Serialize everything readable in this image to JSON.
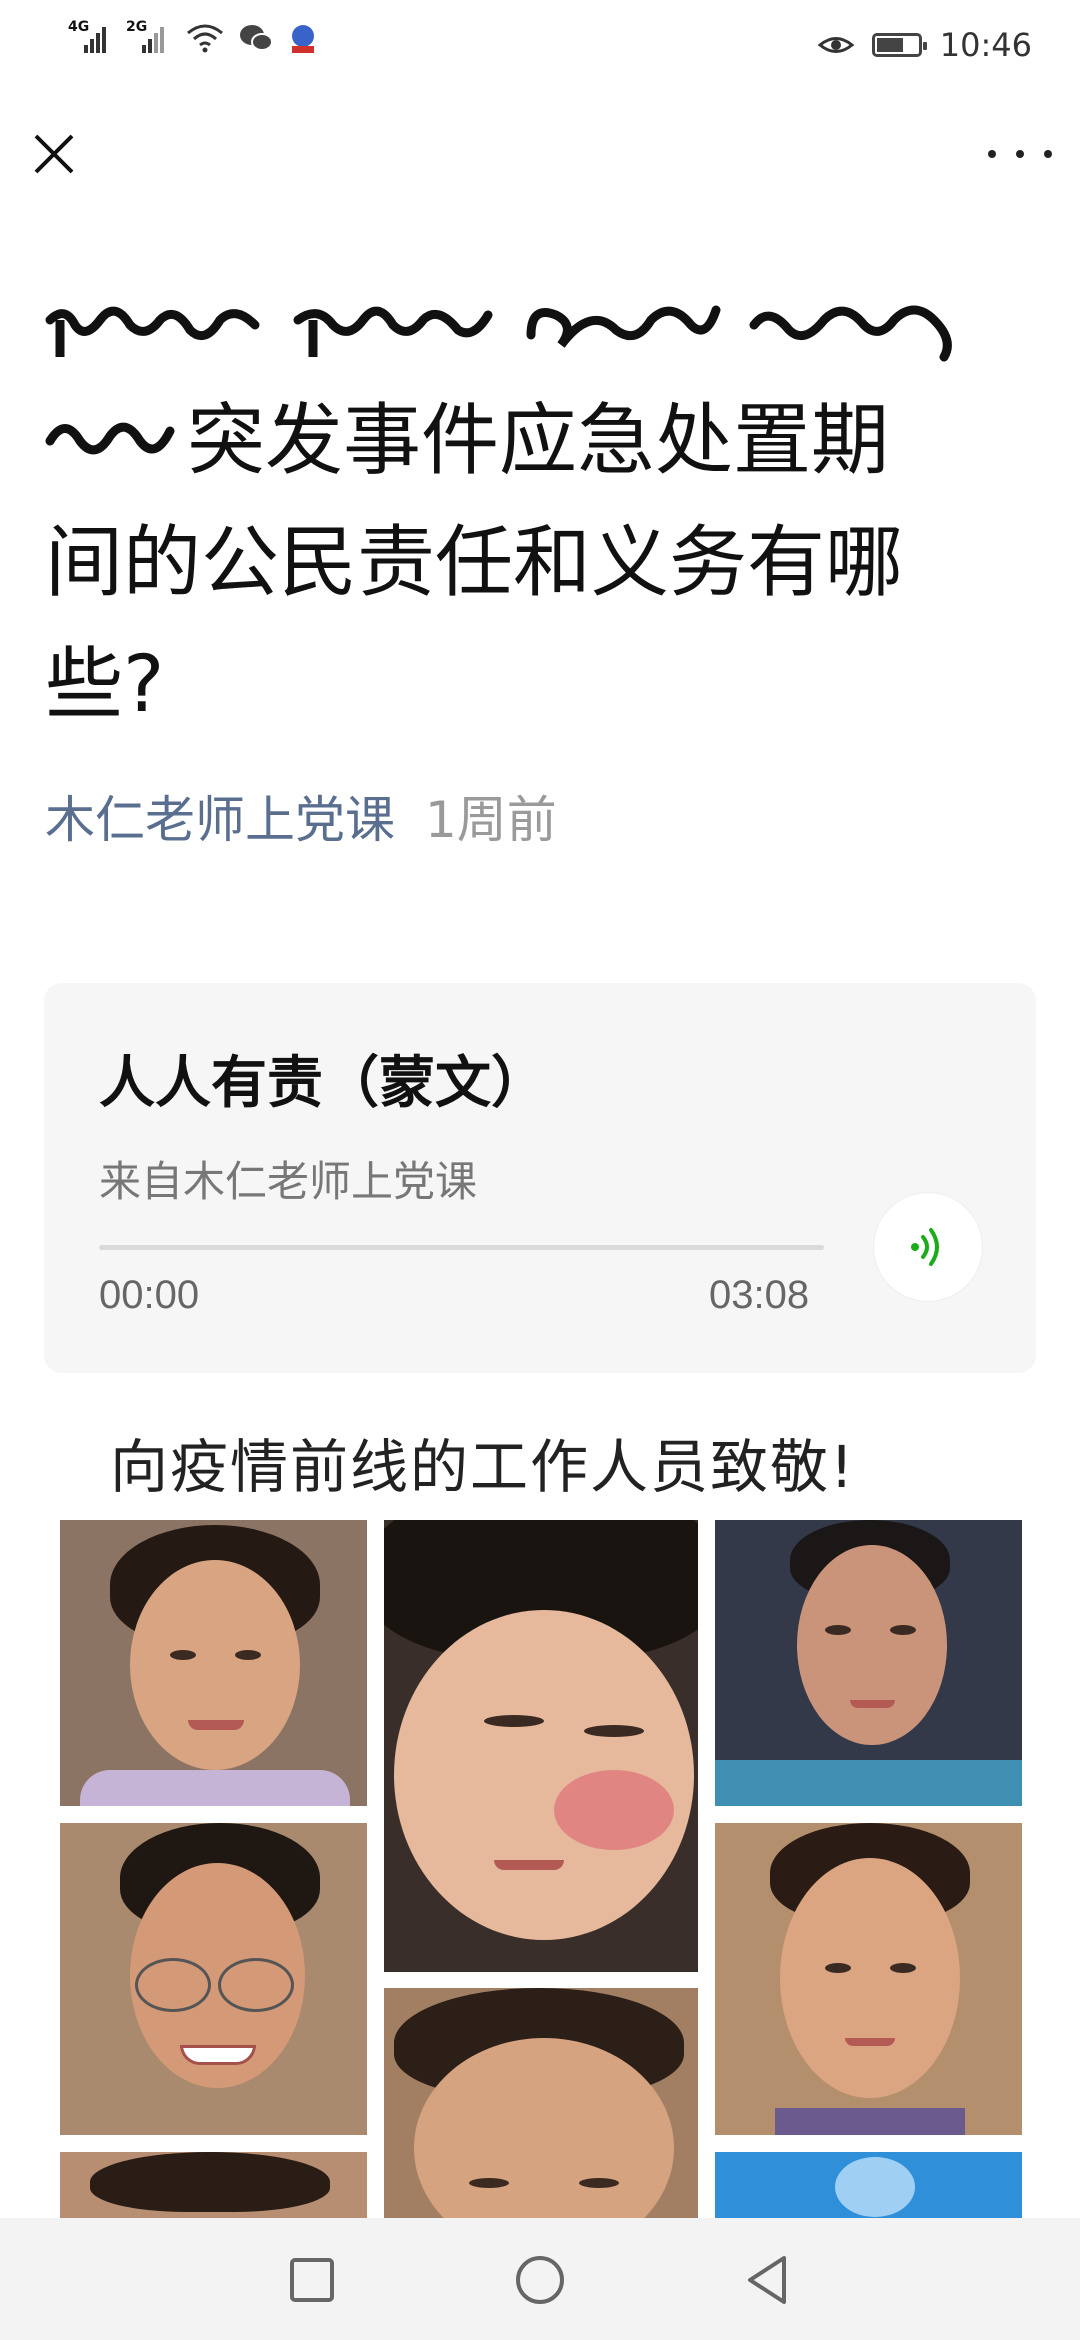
{
  "status_bar": {
    "time": "10:46",
    "signal_1": "4G",
    "signal_2": "2G",
    "icons": [
      "signal-4g-icon",
      "signal-2g-icon",
      "wifi-icon",
      "wechat-icon",
      "baidu-icon",
      "eye-icon",
      "battery-icon"
    ]
  },
  "nav": {
    "close_icon": "close-icon",
    "more_icon": "more-dots-icon"
  },
  "article": {
    "title": "突发事件应急处置期间的公民责任和义务有哪些?",
    "title_line1": "突发事件应急处置期",
    "title_line2": "间的公民责任和义务有哪",
    "title_line3": "些?",
    "author": "木仁老师上党课",
    "date": "1周前"
  },
  "audio": {
    "title": "人人有责（蒙文）",
    "source": "来自木仁老师上党课",
    "current_time": "00:00",
    "duration": "03:08",
    "progress_fraction": 0.0
  },
  "tribute": {
    "caption": "向疫情前线的工作人员致敬!"
  },
  "colors": {
    "author_link": "#5a6f8f",
    "play_accent": "#1aad19",
    "card_bg": "#f6f6f6"
  }
}
